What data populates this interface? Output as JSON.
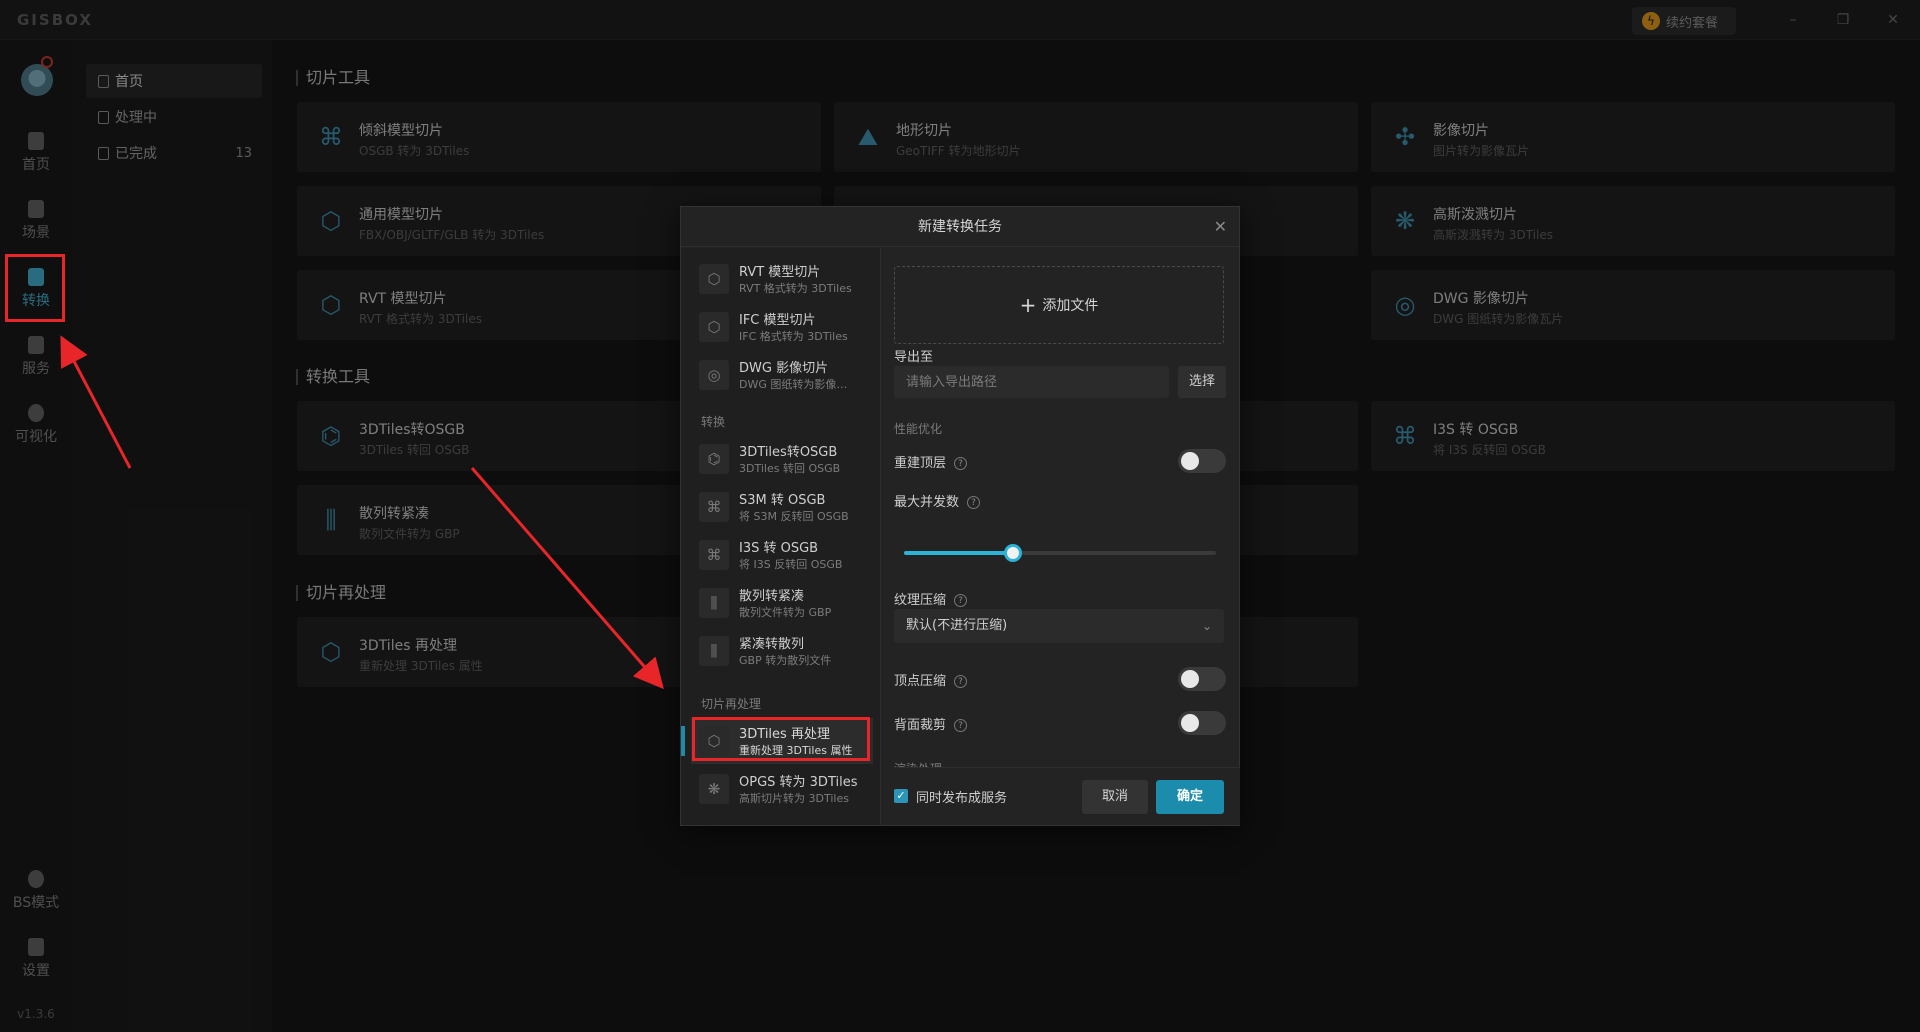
{
  "app": {
    "brand": "GISBOX",
    "renew": "续约套餐",
    "version": "v1.3.6"
  },
  "window": {
    "minimize": "–",
    "maximize": "❐",
    "close": "✕"
  },
  "leftnav": [
    {
      "label": "首页"
    },
    {
      "label": "场景"
    },
    {
      "label": "转换"
    },
    {
      "label": "服务"
    },
    {
      "label": "可视化"
    },
    {
      "label": "BS模式"
    },
    {
      "label": "设置"
    }
  ],
  "secondnav": [
    {
      "label": "首页",
      "count": ""
    },
    {
      "label": "处理中",
      "count": ""
    },
    {
      "label": "已完成",
      "count": "13"
    }
  ],
  "sections": [
    {
      "title": "切片工具"
    },
    {
      "title": "转换工具"
    },
    {
      "title": "切片再处理"
    }
  ],
  "cards": [
    {
      "title": "倾斜模型切片",
      "sub": "OSGB 转为 3DTiles"
    },
    {
      "title": "地形切片",
      "sub": "GeoTIFF 转为地形切片"
    },
    {
      "title": "影像切片",
      "sub": "图片转为影像瓦片"
    },
    {
      "title": "通用模型切片",
      "sub": "FBX/OBJ/GLTF/GLB 转为 3DTiles"
    },
    {
      "title": "高斯泼溅切片",
      "sub": "高斯泼溅转为 3DTiles"
    },
    {
      "title": "RVT 模型切片",
      "sub": "RVT 格式转为 3DTiles"
    },
    {
      "title": "DWG 影像切片",
      "sub": "DWG 图纸转为影像瓦片"
    },
    {
      "title": "3DTiles转OSGB",
      "sub": "3DTiles 转回 OSGB"
    },
    {
      "title": "I3S 转 OSGB",
      "sub": "将 I3S 反转回 OSGB"
    },
    {
      "title": "散列转紧凑",
      "sub": "散列文件转为 GBP"
    },
    {
      "title": "3DTiles 再处理",
      "sub": "重新处理 3DTiles 属性"
    }
  ],
  "modal": {
    "title": "新建转换任务",
    "close": "✕",
    "groups": {
      "convert": "转换",
      "reprocess": "切片再处理"
    },
    "items": [
      {
        "title": "RVT 模型切片",
        "sub": "RVT 格式转为 3DTiles"
      },
      {
        "title": "IFC 模型切片",
        "sub": "IFC 格式转为 3DTiles"
      },
      {
        "title": "DWG 影像切片",
        "sub": "DWG 图纸转为影像…"
      },
      {
        "title": "3DTiles转OSGB",
        "sub": "3DTiles 转回 OSGB"
      },
      {
        "title": "S3M 转 OSGB",
        "sub": "将 S3M 反转回 OSGB"
      },
      {
        "title": "I3S 转 OSGB",
        "sub": "将 I3S 反转回 OSGB"
      },
      {
        "title": "散列转紧凑",
        "sub": "散列文件转为 GBP"
      },
      {
        "title": "紧凑转散列",
        "sub": "GBP 转为散列文件"
      },
      {
        "title": "3DTiles 再处理",
        "sub": "重新处理 3DTiles 属性"
      },
      {
        "title": "OPGS 转为 3DTiles",
        "sub": "高斯切片转为 3DTiles"
      }
    ],
    "form": {
      "add_file": "添加文件",
      "export_label": "导出至",
      "path_placeholder": "请输入导出路径",
      "choose": "选择",
      "perf_label": "性能优化",
      "rebuild_top": "重建顶层",
      "rebuild_top_on": false,
      "max_concurrency": "最大并发数",
      "concurrency_fraction": 0.35,
      "texture_compress": "纹理压缩",
      "texture_value": "默认(不进行压缩)",
      "vertex_compress": "顶点压缩",
      "vertex_on": false,
      "backface_cull": "背面裁剪",
      "backface_on": false,
      "extra_label": "渲染处理"
    },
    "footer": {
      "publish": "同时发布成服务",
      "publish_checked": true,
      "cancel": "取消",
      "ok": "确定"
    }
  },
  "colors": {
    "accent": "#1b8cac",
    "annotation": "#e8262a"
  }
}
